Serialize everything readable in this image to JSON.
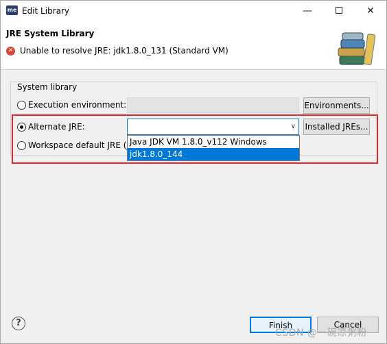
{
  "window": {
    "app_icon_text": "me",
    "title": "Edit Library",
    "min_symbol": "—",
    "close_symbol": "✕"
  },
  "header": {
    "title": "JRE System Library",
    "error_message": "Unable to resolve JRE: jdk1.8.0_131 (Standard VM)",
    "error_icon_symbol": "✕"
  },
  "group": {
    "label": "System library",
    "options": {
      "execution_environment": "Execution environment:",
      "alternate_jre": "Alternate JRE:",
      "workspace_default": "Workspace default JRE (j"
    }
  },
  "buttons": {
    "environments": "Environments...",
    "installed_jres": "Installed JREs...",
    "finish": "Finish",
    "cancel": "Cancel"
  },
  "alternate_jre_combo": {
    "value": "",
    "chevron": "∨"
  },
  "dropdown": {
    "items": [
      "Java JDK VM 1.8.0_v112 Windows",
      "jdk1.8.0_144"
    ],
    "selected_index": 1
  },
  "help_symbol": "?",
  "watermark": "CSDN @一碗凉粥粉",
  "colors": {
    "accent": "#0078d7",
    "highlight_box": "#e8232a",
    "error": "#d9453a"
  }
}
